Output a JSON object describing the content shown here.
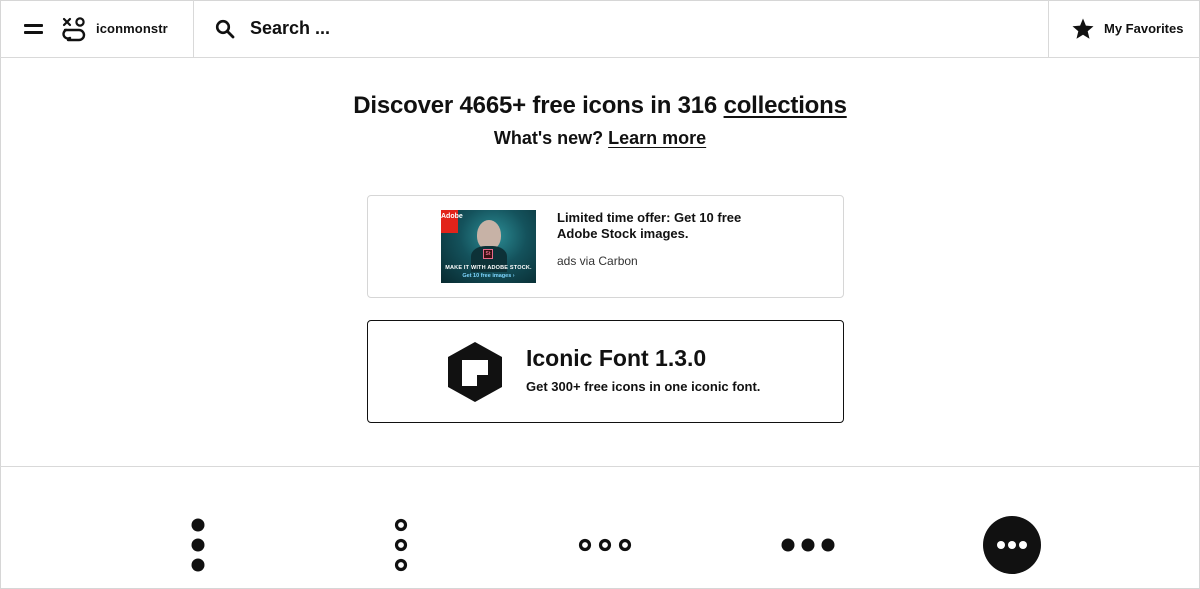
{
  "header": {
    "brand_name": "iconmonstr",
    "search_placeholder": "Search ...",
    "favorites_label": "My Favorites"
  },
  "hero": {
    "headline_prefix": "Discover 4665+ free icons in 316 ",
    "headline_link": "collections",
    "subline_prefix": "What's new? ",
    "subline_link": "Learn more"
  },
  "ad": {
    "offer_text": "Limited time offer: Get 10 free Adobe Stock images.",
    "via_text": "ads via Carbon",
    "image_brand": "Adobe",
    "image_badge": "St",
    "image_tagline": "MAKE IT WITH ADOBE STOCK.",
    "image_cta": "Get 10 free images ›"
  },
  "promo": {
    "title": "Iconic Font 1.3.0",
    "subtitle": "Get 300+ free icons in one iconic font."
  },
  "icon_grid": [
    {
      "name": "menu-dot-vertical-filled-icon"
    },
    {
      "name": "menu-dot-vertical-outline-icon"
    },
    {
      "name": "menu-dot-horizontal-outline-icon"
    },
    {
      "name": "menu-dot-horizontal-filled-icon"
    },
    {
      "name": "menu-dot-circle-icon"
    }
  ],
  "colors": {
    "text": "#111111",
    "border": "#d9d9d9",
    "background": "#ffffff"
  }
}
